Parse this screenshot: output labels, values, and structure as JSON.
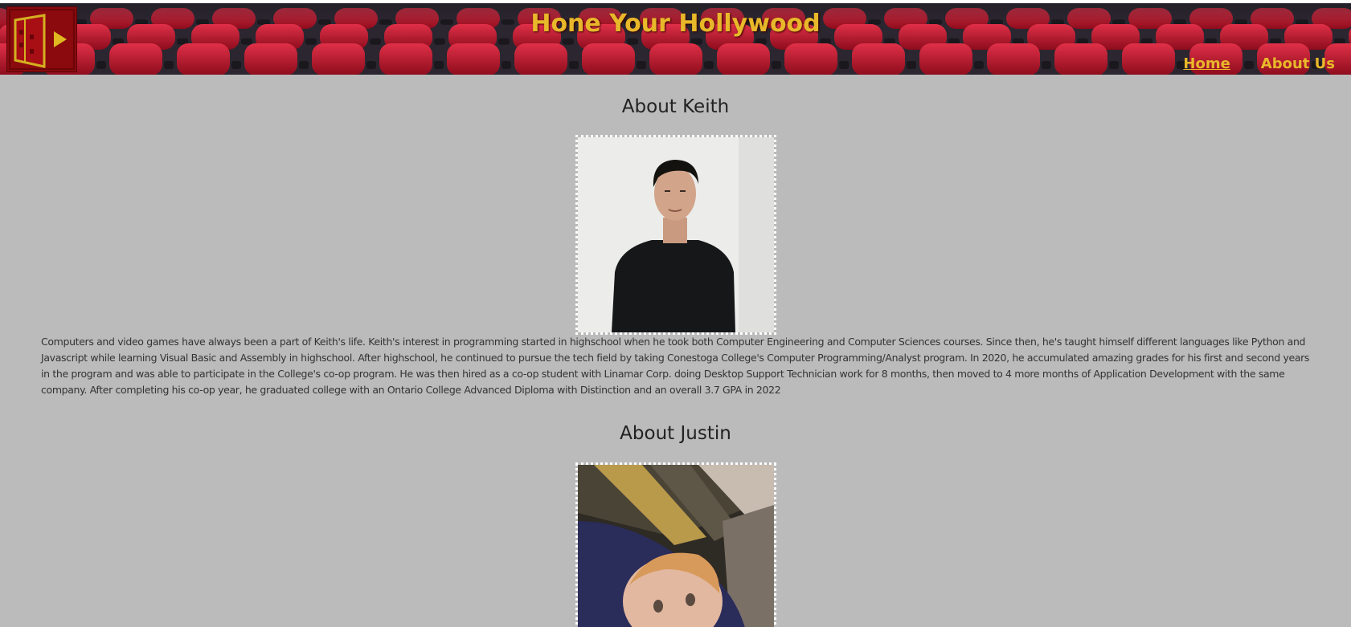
{
  "header": {
    "title": "Hone Your Hollywood",
    "logo_icon": "film-door-play-icon",
    "colors": {
      "title": "#e8b82a",
      "seat_red": "#c8162e",
      "logo_bg": "#8a0a0e"
    }
  },
  "nav": {
    "home_label": "Home",
    "about_label": "About Us"
  },
  "sections": [
    {
      "heading": "About Keith",
      "bio": "Computers and video games have always been a part of Keith's life. Keith's interest in programming started in highschool when he took both Computer Engineering and Computer Sciences courses. Since then, he's taught himself different languages like Python and Javascript while learning Visual Basic and Assembly in highschool. After highschool, he continued to pursue the tech field by taking Conestoga College's Computer Programming/Analyst program. In 2020, he accumulated amazing grades for his first and second years in the program and was able to participate in the College's co-op program. He was then hired as a co-op student with Linamar Corp. doing Desktop Support Technician work for 8 months, then moved to 4 more months of Application Development with the same company. After completing his co-op year, he graduated college with an Ontario College Advanced Diploma with Distinction and an overall 3.7 GPA in 2022"
    },
    {
      "heading": "About Justin"
    }
  ],
  "colors": {
    "page_bg": "#bbbbbb",
    "text": "#333333",
    "photo_border": "#ffffff"
  }
}
